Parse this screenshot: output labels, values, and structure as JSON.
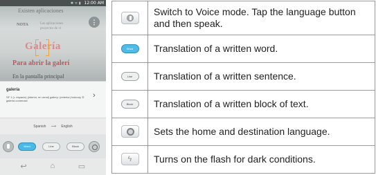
{
  "phone": {
    "status": {
      "time": "12:00 AM",
      "icons": "✱ ᯤ ▮"
    },
    "camera": {
      "line1": "Existen aplicaciones",
      "nota": "NOTA",
      "small": "Las aplicaciones\nproyector de vi",
      "galeria": "Galería",
      "para": "Para abrir la galerí",
      "pantalla": "En la pantalla principal",
      "menu_glyph": "⋮"
    },
    "result": {
      "word": "galería",
      "definitions": "SF 1 (= espacio) (interior, en ornal) gallery; (exterior) balcony ② galería comercial",
      "chevron": "›"
    },
    "language_bar": {
      "source": "Spanish",
      "arrow": "⟶",
      "target": "English"
    },
    "modes": {
      "word": "Word",
      "line": "Line",
      "block": "Block"
    },
    "nav": {
      "back": "↩",
      "home": "⌂",
      "recent": "▭"
    }
  },
  "table": {
    "rows": [
      {
        "icon": "mic-button-icon",
        "text": "Switch to Voice mode. Tap the language button and then speak."
      },
      {
        "icon": "word-mode-icon",
        "label": "Word",
        "text": "Translation of a written word."
      },
      {
        "icon": "line-mode-icon",
        "label": "Line",
        "text": "Translation of a written sentence."
      },
      {
        "icon": "block-mode-icon",
        "label": "Block",
        "text": "Translation of a written block of text."
      },
      {
        "icon": "settings-icon",
        "text": "Sets the home and destination language."
      },
      {
        "icon": "flash-icon",
        "text": "Turns on the flash for dark conditions."
      }
    ]
  },
  "colors": {
    "accent_blue": "#49b9e6",
    "table_border": "#999999",
    "focus_orange": "#f1a23a"
  }
}
